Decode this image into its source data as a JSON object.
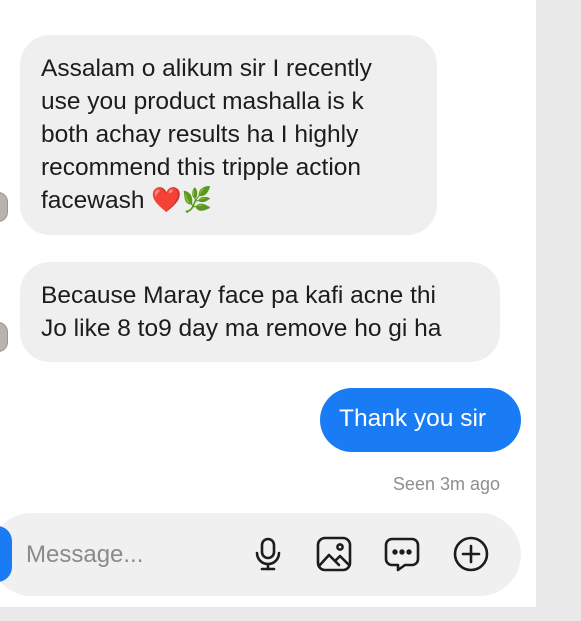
{
  "thread": {
    "messages": [
      {
        "from": "them",
        "text": "Assalam o alikum sir I recently\nuse you product mashalla is k\nboth achay results ha I highly\nrecommend this tripple action\nfacewash",
        "emoji": "❤️🌿"
      },
      {
        "from": "them",
        "text": "Because Maray face pa kafi acne thi\nJo like 8 to9 day ma remove ho gi ha"
      },
      {
        "from": "me",
        "text": "Thank you sir"
      }
    ],
    "seen_status": "Seen 3m ago"
  },
  "composer": {
    "placeholder": "Message...",
    "value": "",
    "icons": [
      "microphone-icon",
      "gallery-icon",
      "sticker-icon",
      "add-icon"
    ]
  },
  "colors": {
    "accent": "#1a7cf4",
    "incoming_bubble": "#efefef",
    "background": "#ffffff",
    "heart": "#e3262e"
  }
}
